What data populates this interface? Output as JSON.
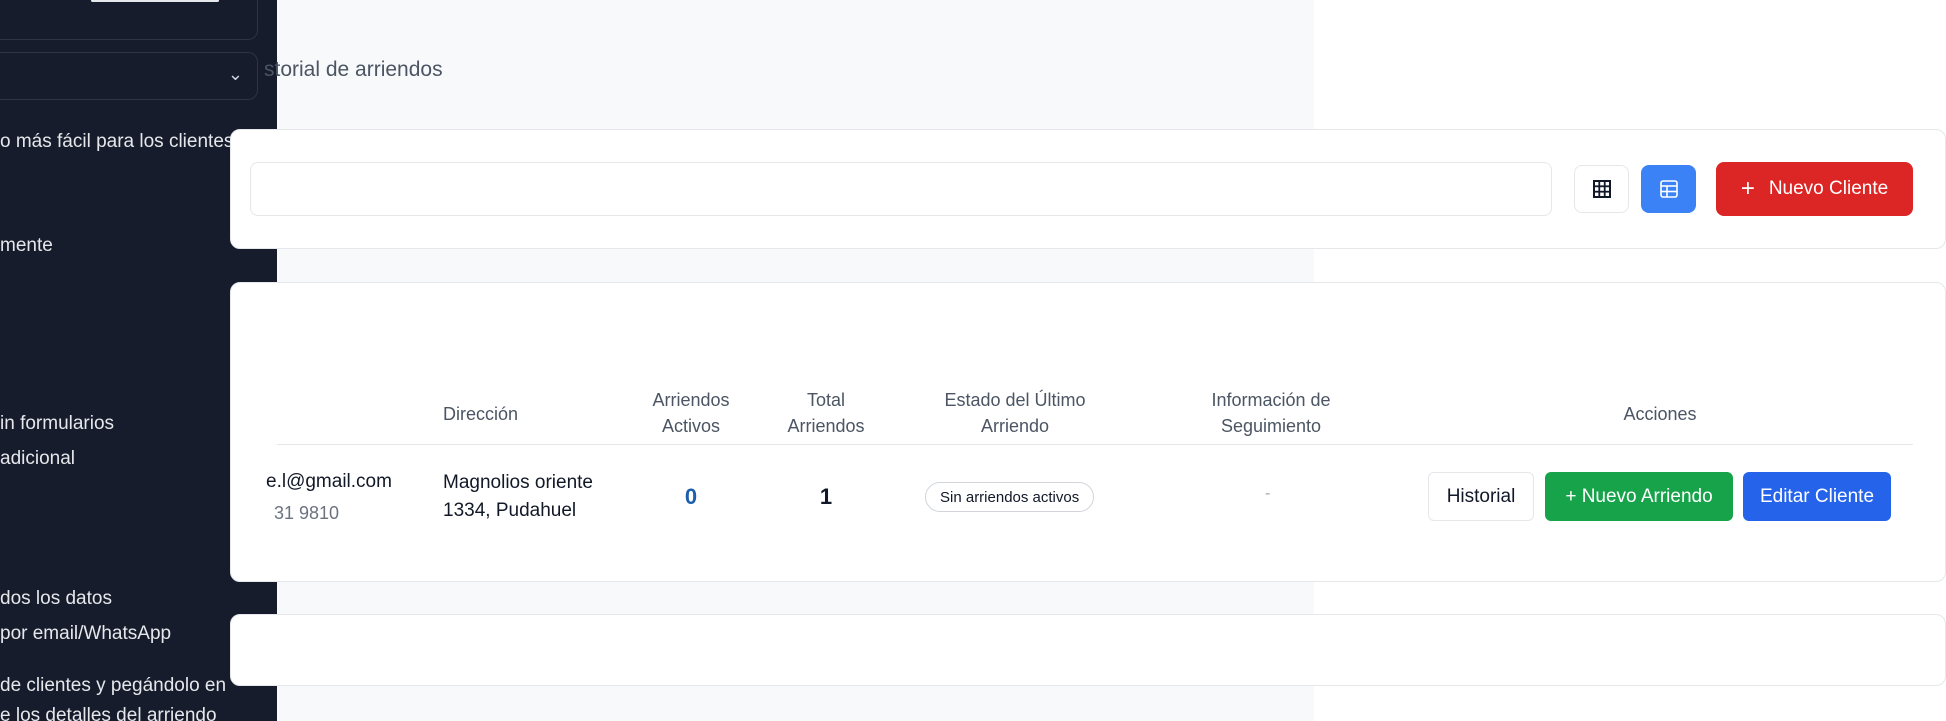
{
  "sidebar": {
    "lines": [
      "o más fácil para los clientes:",
      "mente",
      "in formularios",
      "adicional",
      "dos los datos",
      "por email/WhatsApp",
      "de clientes y pegándolo en",
      "e los detalles del arriendo"
    ]
  },
  "page": {
    "history_partial": "storial de arriendos"
  },
  "toolbar": {
    "new_client_label": "Nuevo Cliente"
  },
  "table": {
    "headers": {
      "direccion": "Dirección",
      "activos": [
        "Arriendos",
        "Activos"
      ],
      "total": [
        "Total",
        "Arriendos"
      ],
      "estado": [
        "Estado del Último",
        "Arriendo"
      ],
      "info": [
        "Información de",
        "Seguimiento"
      ],
      "acciones": "Acciones"
    },
    "rows": [
      {
        "email_partial": "e.l@gmail.com",
        "phone_partial": "31 9810",
        "address_line1": "Magnolios oriente",
        "address_line2": "1334, Pudahuel",
        "active_rentals": "0",
        "total_rentals": "1",
        "status": "Sin arriendos activos",
        "followup": "-",
        "actions": {
          "history": "Historial",
          "new_rental": "+ Nuevo Arriendo",
          "edit": "Editar Cliente"
        }
      }
    ]
  },
  "colors": {
    "primary_red": "#dc2626",
    "primary_blue": "#2563eb",
    "accent_blue": "#3b82f6",
    "success_green": "#16a34a",
    "sidebar_bg": "#161c2b"
  }
}
